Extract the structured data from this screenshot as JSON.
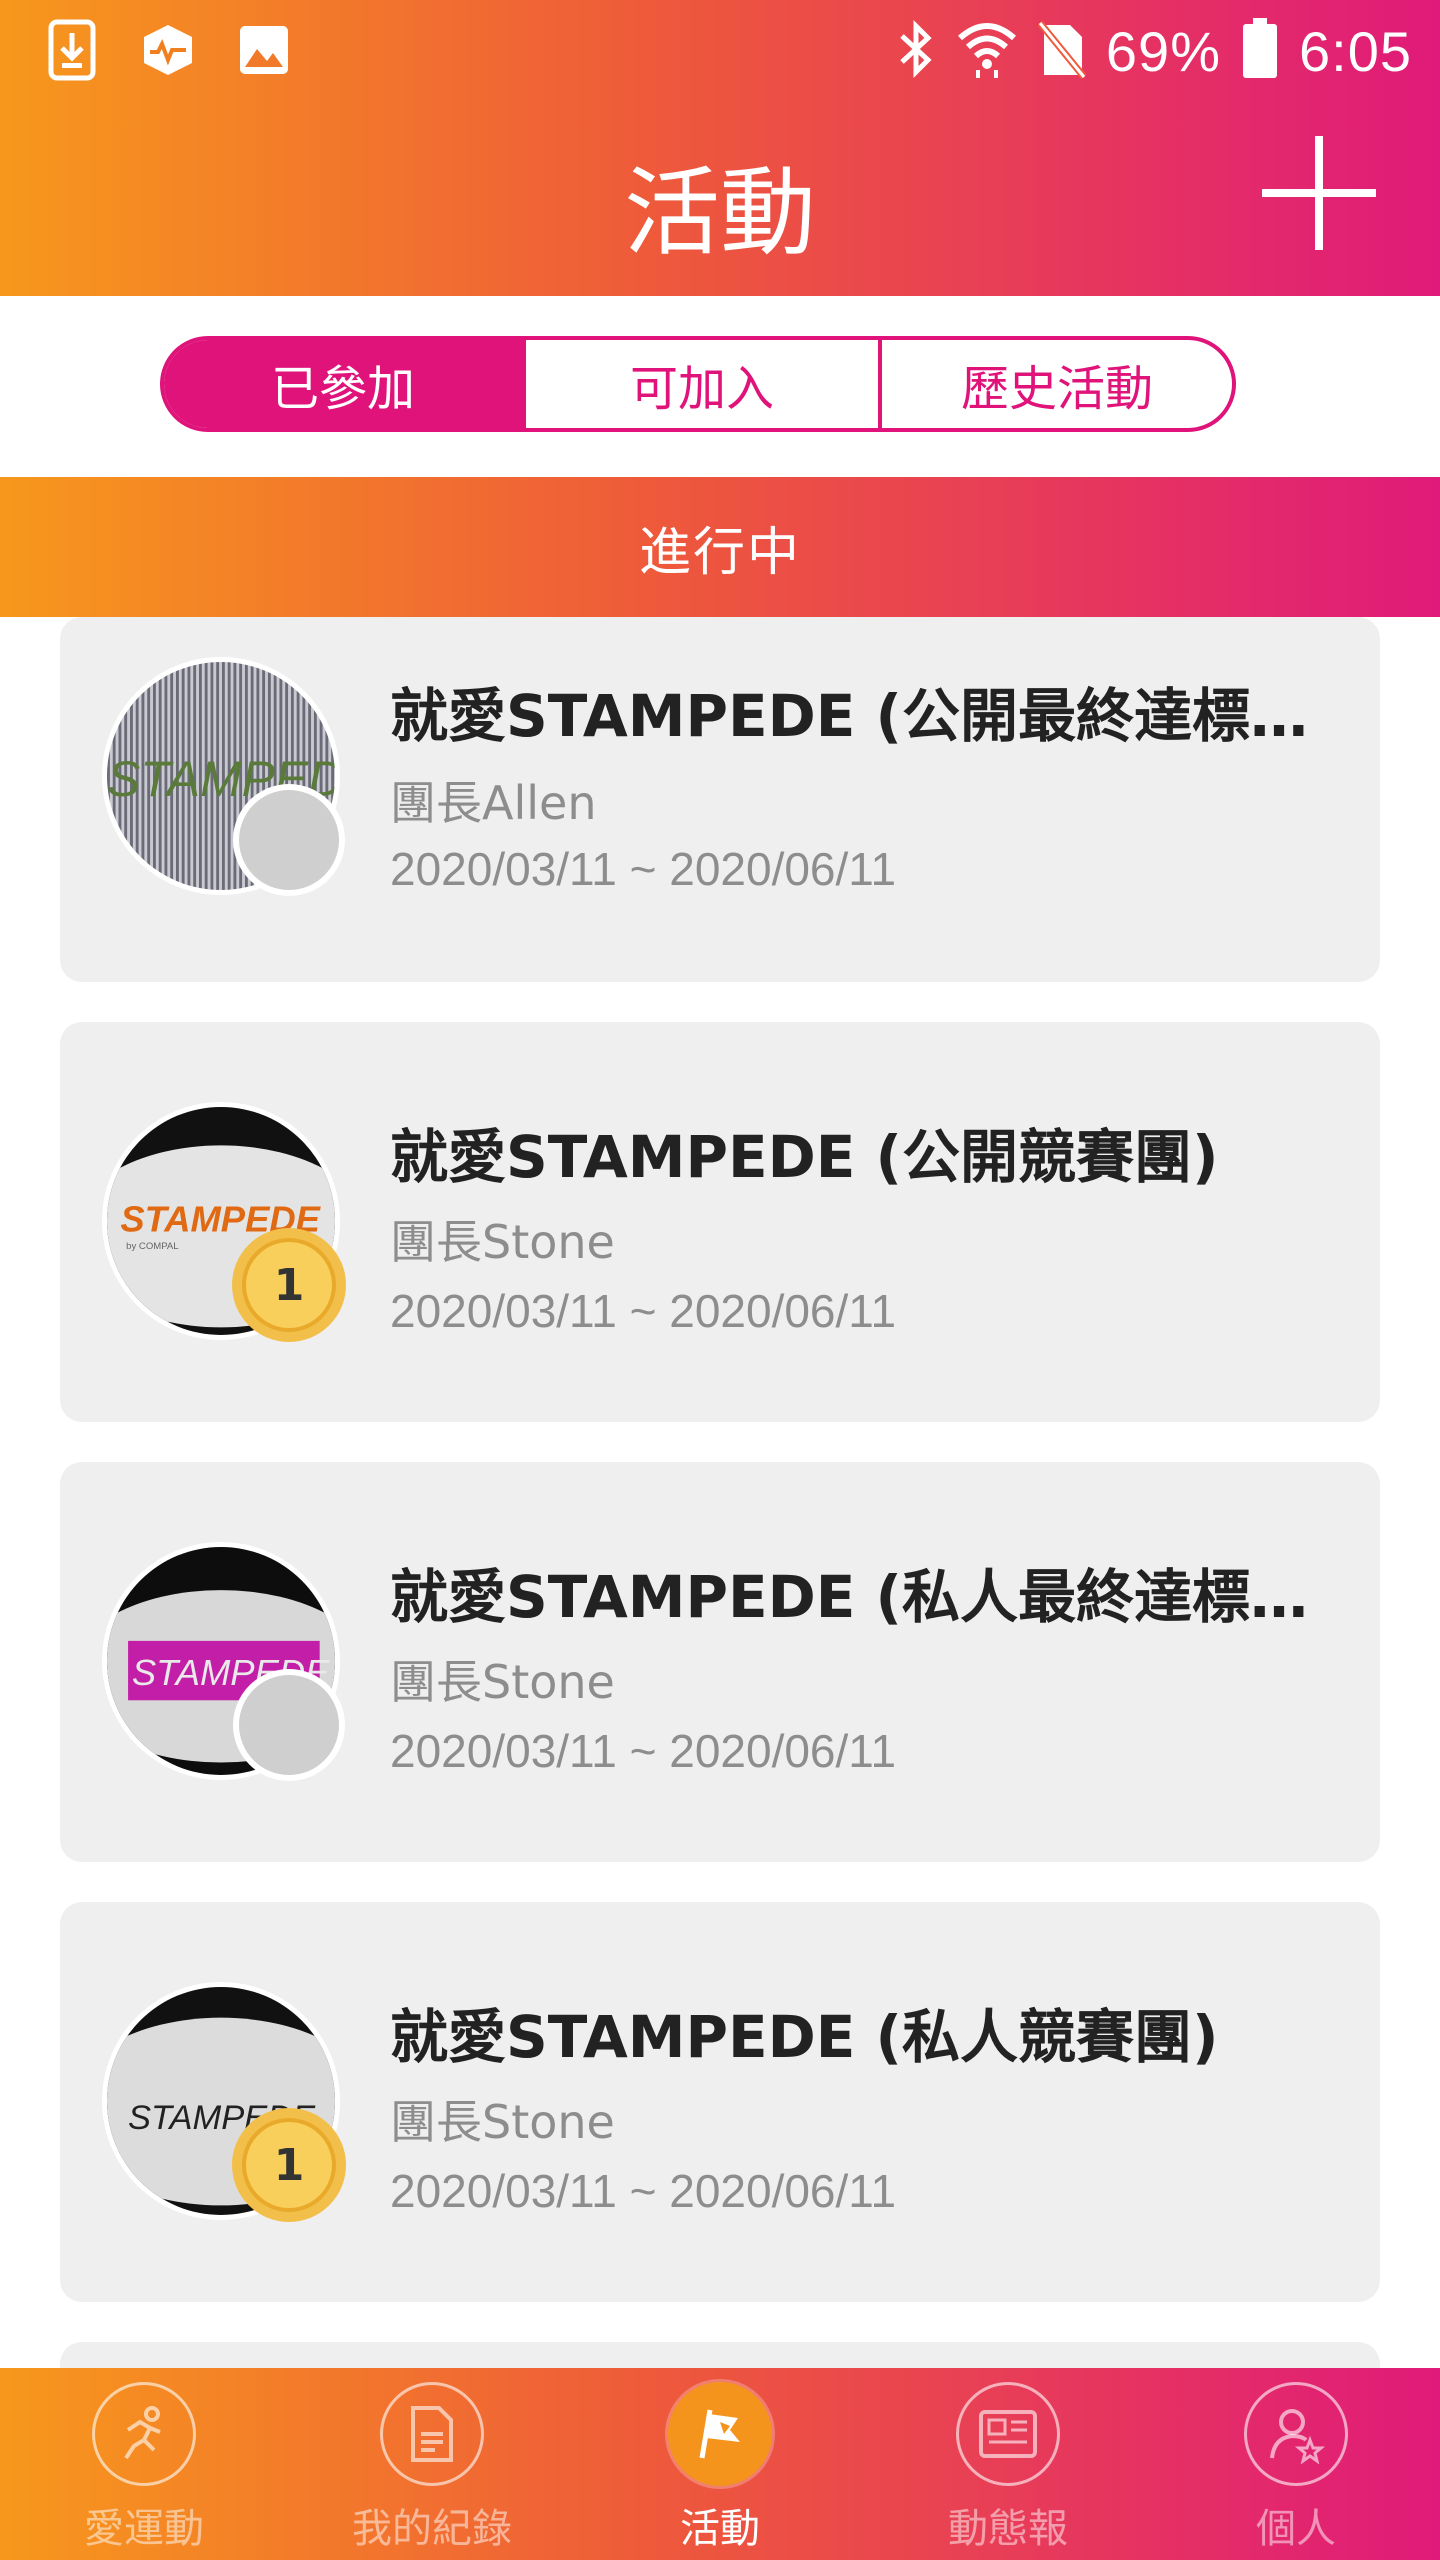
{
  "status_bar": {
    "battery": "69%",
    "time": "6:05",
    "icons": [
      "download-icon",
      "app-icon",
      "image-icon",
      "bluetooth-icon",
      "wifi-icon",
      "no-sim-icon",
      "battery-icon"
    ]
  },
  "header": {
    "title": "活動",
    "add_icon": "plus-icon"
  },
  "tabs": [
    {
      "label": "已參加",
      "active": true
    },
    {
      "label": "可加入",
      "active": false
    },
    {
      "label": "歷史活動",
      "active": false
    }
  ],
  "section_title": "進行中",
  "activities": [
    {
      "title": "就愛STAMPEDE (公開最終達標…",
      "leader": "團長Allen",
      "dates": "2020/03/11 ~ 2020/06/11",
      "badge": ""
    },
    {
      "title": "就愛STAMPEDE (公開競賽團)",
      "leader": "團長Stone",
      "dates": "2020/03/11 ~ 2020/06/11",
      "badge": "1"
    },
    {
      "title": "就愛STAMPEDE (私人最終達標…",
      "leader": "團長Stone",
      "dates": "2020/03/11 ~ 2020/06/11",
      "badge": ""
    },
    {
      "title": "就愛STAMPEDE (私人競賽團)",
      "leader": "團長Stone",
      "dates": "2020/03/11 ~ 2020/06/11",
      "badge": "1"
    }
  ],
  "avatar_text": {
    "a0": "STAMPEDE",
    "a1": "STAMPEDE",
    "a1_sub": "by COMPAL",
    "a2": "STAMPEDE",
    "a3": "STAMPEDE"
  },
  "bottom_nav": [
    {
      "label": "愛運動",
      "icon": "runner-icon",
      "active": false
    },
    {
      "label": "我的紀錄",
      "icon": "document-icon",
      "active": false
    },
    {
      "label": "活動",
      "icon": "flag-icon",
      "active": true
    },
    {
      "label": "動態報",
      "icon": "news-icon",
      "active": false
    },
    {
      "label": "個人",
      "icon": "profile-icon",
      "active": false
    }
  ],
  "colors": {
    "accent": "#e0137a",
    "gradient_start": "#f7981c",
    "gradient_end": "#e01a7a",
    "card_bg": "#efefef"
  }
}
